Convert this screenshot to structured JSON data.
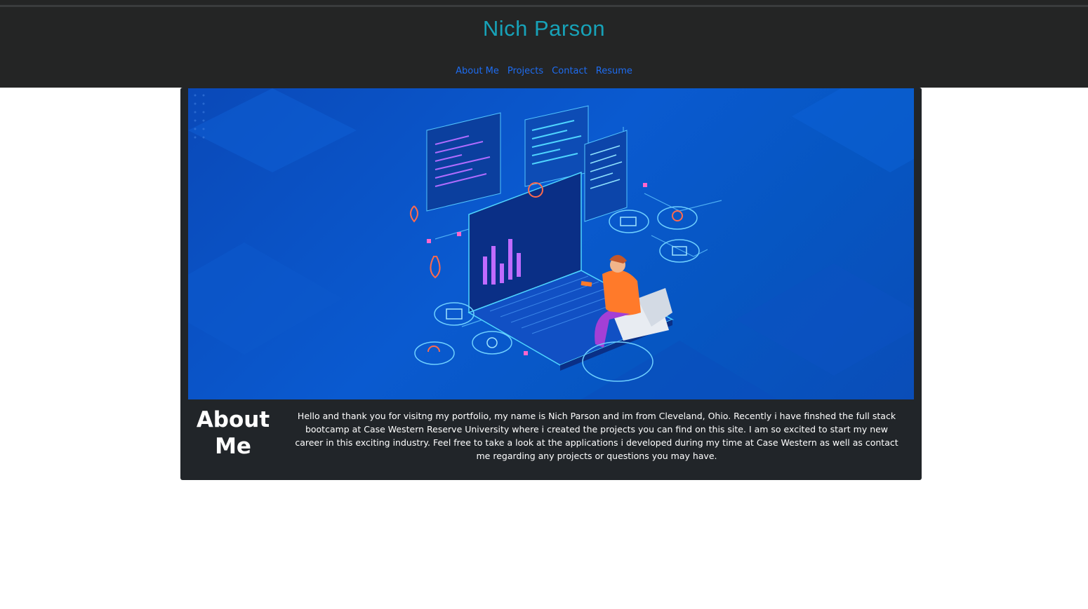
{
  "header": {
    "title": "Nich Parson",
    "title_color": "#17a2b8",
    "nav": [
      {
        "label": "About Me"
      },
      {
        "label": "Projects"
      },
      {
        "label": "Contact"
      },
      {
        "label": "Resume"
      }
    ],
    "nav_color": "#1e6cf0",
    "background": "#242525"
  },
  "hero": {
    "image": "isometric-developer-laptop-illustration",
    "background": "#0a54c6"
  },
  "about": {
    "title": "About Me",
    "text": "Hello and thank you for visitng my portfolio, my name is Nich Parson and im from Cleveland, Ohio. Recently i have finshed the full stack bootcamp at Case Western Reserve University where i created the projects you can find on this site. I am so excited to start my new career in this exciting industry. Feel free to take a look at the applications i developed during my time at Case Western as well as contact me regarding any projects or questions you may have."
  },
  "card": {
    "background": "#212529"
  }
}
